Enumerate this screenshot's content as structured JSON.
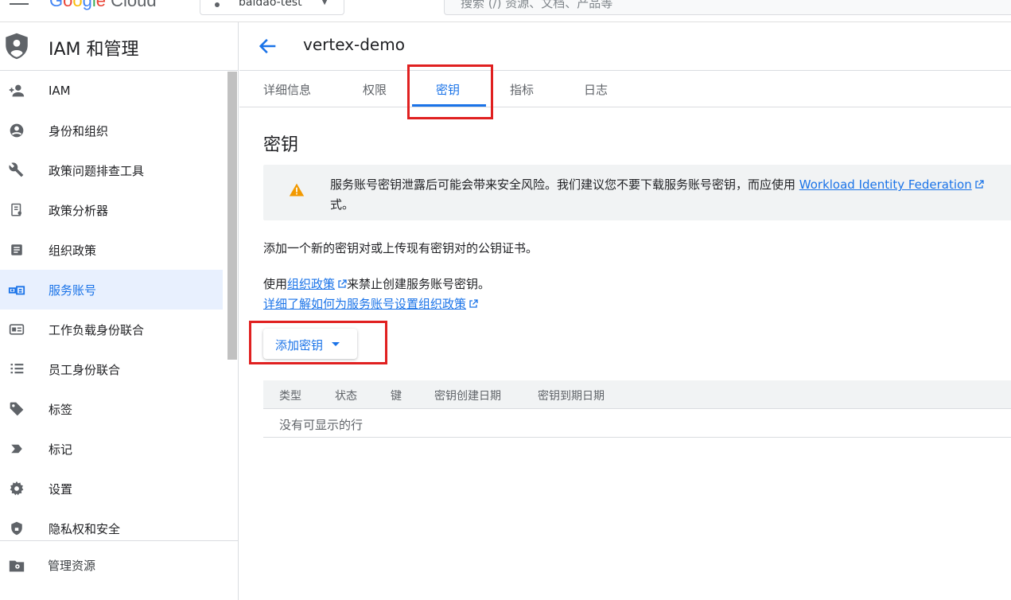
{
  "topbar": {
    "logo": {
      "g": "G",
      "o1": "o",
      "o2": "o",
      "g2": "g",
      "l": "l",
      "e": "e",
      "rest": " Cloud"
    },
    "project": "baidao-test",
    "search_placeholder": "搜索 (/) 资源、文档、产品等"
  },
  "sidebar": {
    "title": "IAM 和管理",
    "items": [
      {
        "label": "IAM",
        "icon": "person-add-icon"
      },
      {
        "label": "身份和组织",
        "icon": "account-circle-icon"
      },
      {
        "label": "政策问题排查工具",
        "icon": "wrench-icon"
      },
      {
        "label": "政策分析器",
        "icon": "policy-analyzer-icon"
      },
      {
        "label": "组织政策",
        "icon": "article-icon"
      },
      {
        "label": "服务账号",
        "icon": "service-account-icon",
        "active": true
      },
      {
        "label": "工作负载身份联合",
        "icon": "badge-icon"
      },
      {
        "label": "员工身份联合",
        "icon": "list-icon"
      },
      {
        "label": "标签",
        "icon": "tag-icon"
      },
      {
        "label": "标记",
        "icon": "label-icon"
      },
      {
        "label": "设置",
        "icon": "gear-icon"
      },
      {
        "label": "隐私权和安全",
        "icon": "shield-lock-icon"
      }
    ],
    "bottom": {
      "label": "管理资源",
      "icon": "folder-settings-icon"
    }
  },
  "header": {
    "title": "vertex-demo"
  },
  "tabs": [
    {
      "label": "详细信息"
    },
    {
      "label": "权限"
    },
    {
      "label": "密钥",
      "active": true
    },
    {
      "label": "指标"
    },
    {
      "label": "日志"
    }
  ],
  "content": {
    "section_title": "密钥",
    "warning": {
      "text": "服务账号密钥泄露后可能会带来安全风险。我们建议您不要下载服务账号密钥，而应使用 ",
      "link": "Workload Identity Federation",
      "line2": "式。"
    },
    "p1": "添加一个新的密钥对或上传现有密钥对的公钥证书。",
    "p2_prefix": "使用",
    "p2_link": "组织政策",
    "p2_suffix": "来禁止创建服务账号密钥。",
    "p3_link": "详细了解如何为服务账号设置组织政策",
    "add_button": "添加密钥",
    "table": {
      "columns": [
        "类型",
        "状态",
        "键",
        "密钥创建日期",
        "密钥到期日期"
      ],
      "empty": "没有可显示的行"
    }
  },
  "colors": {
    "accent": "#1a73e8",
    "highlight": "#e02020"
  }
}
